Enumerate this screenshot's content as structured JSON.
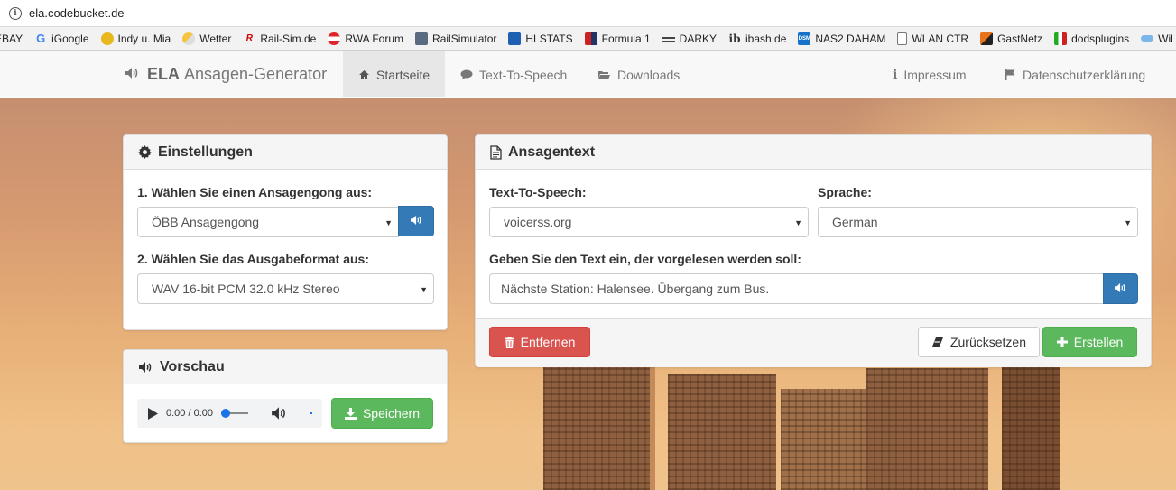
{
  "browser": {
    "url": "ela.codebucket.de",
    "bookmarks": [
      {
        "label": "EBAY",
        "icon": "none"
      },
      {
        "label": "iGoogle",
        "icon": "google-icon"
      },
      {
        "label": "Indy u. Mia",
        "icon": "sun-face-icon"
      },
      {
        "label": "Wetter",
        "icon": "weather-icon"
      },
      {
        "label": "Rail-Sim.de",
        "icon": "railsim-icon"
      },
      {
        "label": "RWA Forum",
        "icon": "austria-flag-icon"
      },
      {
        "label": "RailSimulator",
        "icon": "train-icon"
      },
      {
        "label": "HLSTATS",
        "icon": "hlstats-icon"
      },
      {
        "label": "Formula 1",
        "icon": "f1-icon"
      },
      {
        "label": "DARKY",
        "icon": "darky-icon"
      },
      {
        "label": "ibash.de",
        "icon": "ibash-icon"
      },
      {
        "label": "NAS2 DAHAM",
        "icon": "dsm-icon"
      },
      {
        "label": "WLAN CTR",
        "icon": "page-icon"
      },
      {
        "label": "GastNetz",
        "icon": "gastnetz-icon"
      },
      {
        "label": "dodsplugins",
        "icon": "dods-icon"
      },
      {
        "label": "Wil",
        "icon": "link-icon"
      }
    ]
  },
  "nav": {
    "brand_bold": "ELA",
    "brand_rest": "Ansagen-Generator",
    "items": [
      {
        "label": "Startseite",
        "icon": "home-icon",
        "active": true
      },
      {
        "label": "Text-To-Speech",
        "icon": "comment-icon"
      },
      {
        "label": "Downloads",
        "icon": "folder-open-icon"
      }
    ],
    "right_items": [
      {
        "label": "Impressum",
        "icon": "info-icon"
      },
      {
        "label": "Datenschutzerklärung",
        "icon": "flag-icon"
      }
    ]
  },
  "settings": {
    "title": "Einstellungen",
    "gong_label": "1. Wählen Sie einen Ansagengong aus:",
    "gong_value": "ÖBB Ansagengong",
    "format_label": "2. Wählen Sie das Ausgabeformat aus:",
    "format_value": "WAV 16-bit PCM 32.0 kHz Stereo"
  },
  "preview": {
    "title": "Vorschau",
    "time": "0:00 / 0:00",
    "save_label": "Speichern"
  },
  "announcement": {
    "title": "Ansagentext",
    "tts_label": "Text-To-Speech:",
    "tts_value": "voicerss.org",
    "lang_label": "Sprache:",
    "lang_value": "German",
    "text_label": "Geben Sie den Text ein, der vorgelesen werden soll:",
    "text_value": "Nächste Station: Halensee. Übergang zum Bus.",
    "remove_label": "Entfernen",
    "reset_label": "Zurücksetzen",
    "create_label": "Erstellen"
  },
  "colors": {
    "primary": "#337ab7",
    "danger": "#d9534f",
    "success": "#5cb85c"
  }
}
